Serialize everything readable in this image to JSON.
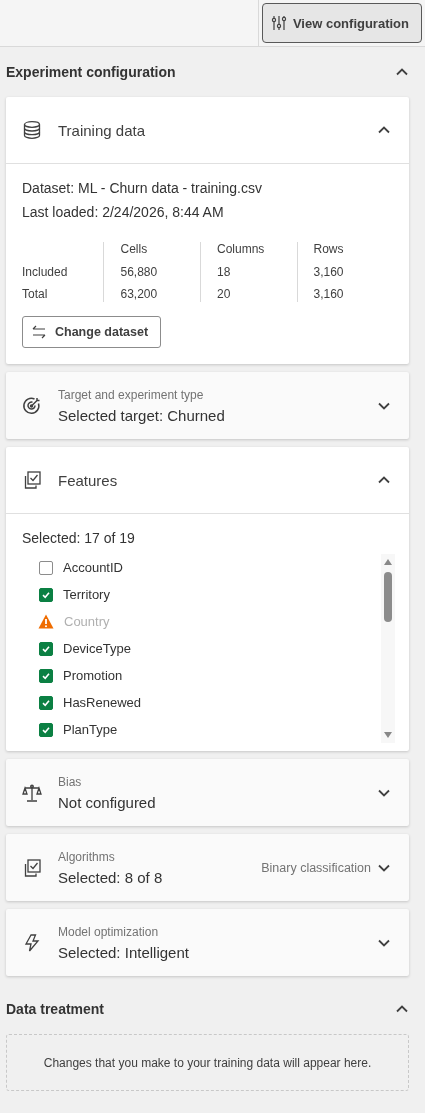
{
  "toolbar": {
    "button": "View configuration"
  },
  "sections": [
    {
      "kind": "cards",
      "title": "Experiment configuration",
      "expanded": true,
      "cards": [
        {
          "kind": "training",
          "title": "Training data",
          "expanded": true,
          "dataset": "Dataset: ML - Churn data - training.csv",
          "last_loaded": "Last loaded: 2/24/2026, 8:44 AM",
          "stats": {
            "columns": [
              "Cells",
              "Columns",
              "Rows"
            ],
            "rows": [
              {
                "label": "Included",
                "values": [
                  "56,880",
                  "18",
                  "3,160"
                ]
              },
              {
                "label": "Total",
                "values": [
                  "63,200",
                  "20",
                  "3,160"
                ]
              }
            ]
          },
          "action": "Change dataset"
        },
        {
          "kind": "summary",
          "label": "Target and experiment type",
          "value": "Selected target: Churned",
          "expanded": false
        },
        {
          "kind": "features",
          "title": "Features",
          "expanded": true,
          "selected_count": "Selected: 17 of 19",
          "items": [
            {
              "kind": "checkbox",
              "label": "AccountID",
              "checked": false
            },
            {
              "kind": "checkbox",
              "label": "Territory",
              "checked": true
            },
            {
              "kind": "warning",
              "label": "Country"
            },
            {
              "kind": "checkbox",
              "label": "DeviceType",
              "checked": true
            },
            {
              "kind": "checkbox",
              "label": "Promotion",
              "checked": true
            },
            {
              "kind": "checkbox",
              "label": "HasRenewed",
              "checked": true
            },
            {
              "kind": "checkbox",
              "label": "PlanType",
              "checked": true
            }
          ]
        },
        {
          "kind": "summary",
          "label": "Bias",
          "value": "Not configured",
          "expanded": false
        },
        {
          "kind": "summary",
          "label": "Algorithms",
          "value": "Selected: 8 of 8",
          "note": "Binary classification",
          "expanded": false
        },
        {
          "kind": "summary",
          "label": "Model optimization",
          "value": "Selected: Intelligent",
          "expanded": false
        }
      ]
    },
    {
      "kind": "empty",
      "title": "Data treatment",
      "expanded": true,
      "message": "Changes that you make to your training data will appear here."
    }
  ]
}
